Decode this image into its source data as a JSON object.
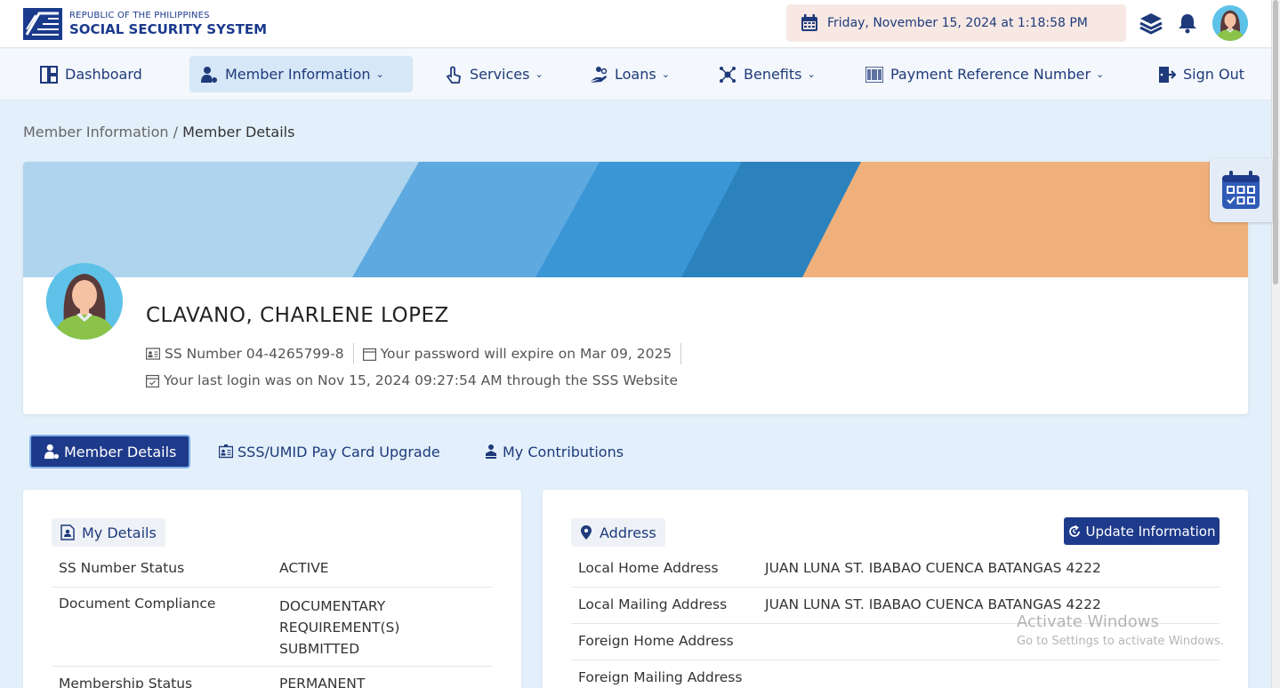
{
  "header": {
    "logo_line1": "REPUBLIC OF THE PHILIPPINES",
    "logo_line2": "SOCIAL SECURITY SYSTEM",
    "datetime": "Friday, November 15, 2024 at 1:18:58 PM"
  },
  "nav": {
    "dashboard": "Dashboard",
    "member_information": "Member Information",
    "services": "Services",
    "loans": "Loans",
    "benefits": "Benefits",
    "prn": "Payment Reference Number",
    "sign_out": "Sign Out"
  },
  "breadcrumb": {
    "parent": "Member Information",
    "separator": " / ",
    "current": "Member Details"
  },
  "profile": {
    "name": "CLAVANO, CHARLENE LOPEZ",
    "ss_number": "SS Number 04-4265799-8",
    "password_expiry": "Your password will expire on Mar 09, 2025",
    "last_login": "Your last login was on Nov 15, 2024 09:27:54 AM through the SSS Website"
  },
  "tabs": {
    "member_details": "Member Details",
    "paycard": "SSS/UMID Pay Card Upgrade",
    "contributions": "My Contributions"
  },
  "my_details": {
    "title": "My Details",
    "rows": [
      {
        "label": "SS Number Status",
        "value": "ACTIVE"
      },
      {
        "label": "Document Compliance",
        "value": "DOCUMENTARY REQUIREMENT(S) SUBMITTED"
      },
      {
        "label": "Membership Status",
        "value": "PERMANENT"
      }
    ]
  },
  "address": {
    "title": "Address",
    "update_button": "Update Information",
    "rows": [
      {
        "label": "Local Home Address",
        "value": "JUAN LUNA ST. IBABAO CUENCA BATANGAS 4222"
      },
      {
        "label": "Local Mailing Address",
        "value": "JUAN LUNA ST. IBABAO CUENCA BATANGAS 4222"
      },
      {
        "label": "Foreign Home Address",
        "value": ""
      },
      {
        "label": "Foreign Mailing Address",
        "value": ""
      }
    ]
  },
  "watermark": {
    "line1": "Activate Windows",
    "line2": "Go to Settings to activate Windows."
  },
  "colors": {
    "brand_navy": "#1e3a8a",
    "banner_light_blue": "#aed4ee",
    "banner_blue": "#5eaae0",
    "banner_mid_blue": "#3b96d6",
    "banner_dark_blue": "#2b82bd",
    "banner_orange": "#efb07b",
    "date_bg": "#f7e8e3"
  },
  "icons": [
    "sss-logo-icon",
    "calendar-icon",
    "layers-icon",
    "bell-icon",
    "user-avatar",
    "dashboard-icon",
    "member-icon",
    "services-icon",
    "loans-icon",
    "benefits-icon",
    "barcode-icon",
    "sign-out-icon",
    "id-card-icon",
    "calendar-check-icon",
    "document-icon",
    "location-pin-icon",
    "refresh-icon"
  ]
}
